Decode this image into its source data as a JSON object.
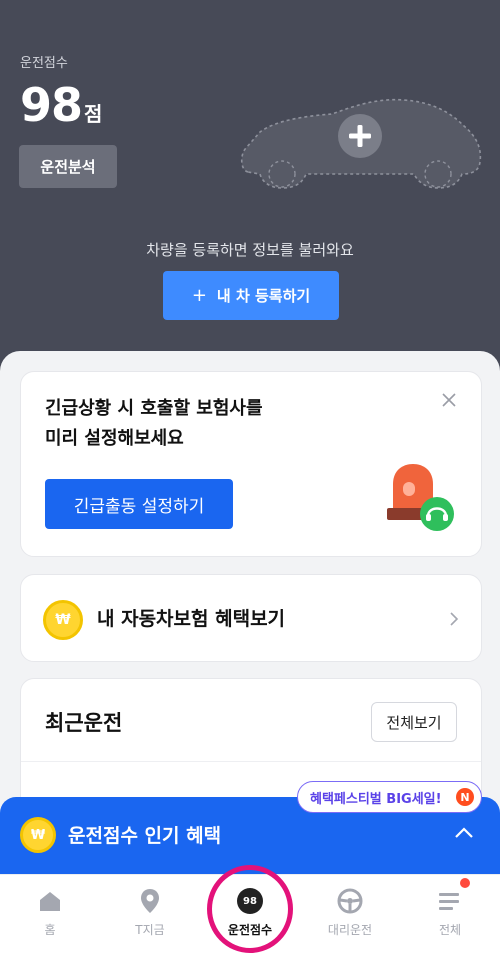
{
  "hero": {
    "score_label": "운전점수",
    "score_value": "98",
    "score_unit": "점",
    "analysis_label": "운전분석",
    "register_prompt": "차량을 등록하면 정보를 불러와요",
    "register_button": "내 차 등록하기",
    "register_plus": "+"
  },
  "emergency_card": {
    "title_line1": "긴급상황 시 호출할 보험사를",
    "title_line2": "미리 설정해보세요",
    "button_label": "긴급출동 설정하기"
  },
  "insurance_card": {
    "coin_symbol": "₩",
    "label": "내 자동차보험 혜택보기"
  },
  "recent_card": {
    "title": "최근운전",
    "view_all_label": "전체보기"
  },
  "promo": {
    "label": "혜택페스티벌 BIG세일!",
    "badge": "N"
  },
  "banner": {
    "coin_symbol": "₩",
    "label": "운전점수 인기 혜택"
  },
  "tabbar": {
    "tabs": [
      {
        "label": "홈",
        "icon": "home-icon"
      },
      {
        "label": "T지금",
        "icon": "location-pin-icon"
      },
      {
        "label": "운전점수",
        "icon": "score-badge-icon",
        "badge": "98",
        "active": true
      },
      {
        "label": "대리운전",
        "icon": "steering-wheel-icon"
      },
      {
        "label": "전체",
        "icon": "menu-icon"
      }
    ]
  },
  "colors": {
    "hero_bg": "#474a57",
    "primary_blue": "#1a66f0",
    "register_blue": "#3e8bff",
    "highlight_ring": "#e3127a",
    "coin_yellow": "#ffd530"
  }
}
